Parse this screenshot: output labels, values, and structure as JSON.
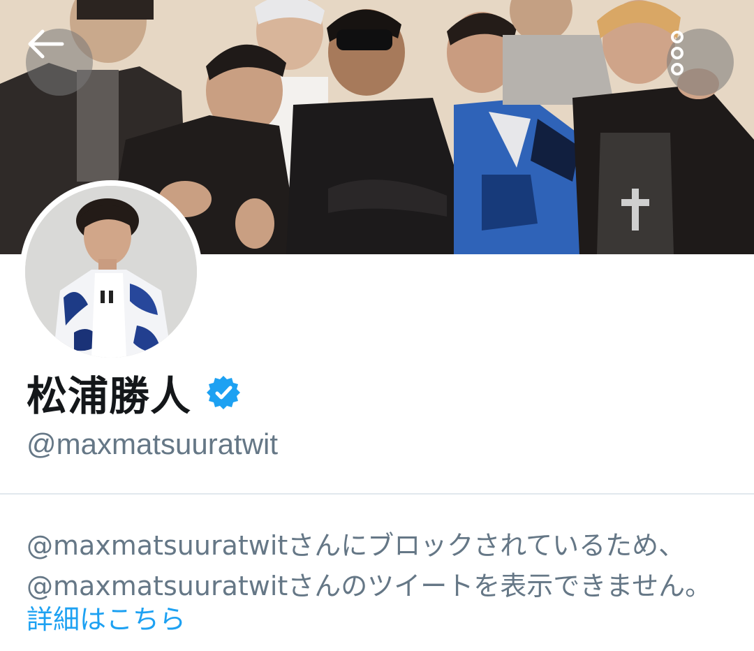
{
  "header": {
    "banner_description": "group-photo-banner",
    "back_icon": "arrow-left-icon",
    "more_icon": "more-vertical-icon"
  },
  "profile": {
    "display_name": "松浦勝人",
    "verified": true,
    "handle": "@maxmatsuuratwit"
  },
  "blocked_notice": {
    "line1": "@maxmatsuuratwitさんにブロックされているため、",
    "line2": "@maxmatsuuratwitさんのツイートを表示できません。",
    "link_label": "詳細はこちら"
  },
  "colors": {
    "text_primary": "#14171a",
    "text_secondary": "#657786",
    "link": "#1da1f2",
    "verified_badge": "#1da1f2",
    "divider": "#e1e8ed"
  }
}
